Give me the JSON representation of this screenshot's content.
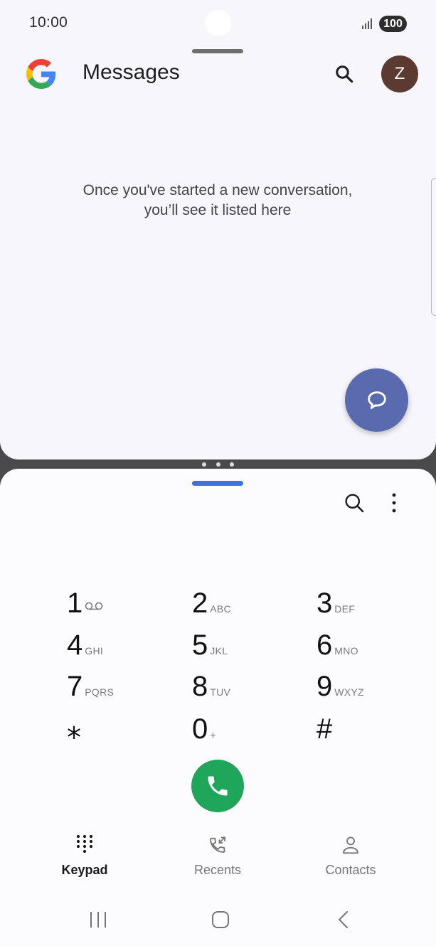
{
  "status_bar": {
    "time": "10:00",
    "battery": "100",
    "signal_icon": "signal-icon"
  },
  "messages": {
    "app_title": "Messages",
    "logo_icon": "google-logo",
    "search_icon": "search-icon",
    "avatar_initial": "Z",
    "avatar_color": "#5b3a32",
    "empty_line1": "Once you've started a new conversation,",
    "empty_line2": "you’ll see it listed here",
    "fab_icon": "start-chat-icon",
    "fab_color": "#5a6aaf"
  },
  "phone": {
    "accent_color": "#3a74e0",
    "call_color": "#1fa65a",
    "keys": [
      {
        "digit": "1",
        "letters": ""
      },
      {
        "digit": "2",
        "letters": "ABC"
      },
      {
        "digit": "3",
        "letters": "DEF"
      },
      {
        "digit": "4",
        "letters": "GHI"
      },
      {
        "digit": "5",
        "letters": "JKL"
      },
      {
        "digit": "6",
        "letters": "MNO"
      },
      {
        "digit": "7",
        "letters": "PQRS"
      },
      {
        "digit": "8",
        "letters": "TUV"
      },
      {
        "digit": "9",
        "letters": "WXYZ"
      },
      {
        "digit": "⁎",
        "letters": ""
      },
      {
        "digit": "0",
        "letters": "+"
      },
      {
        "digit": "#",
        "letters": ""
      }
    ],
    "tabs": [
      {
        "label": "Keypad",
        "icon": "keypad-icon",
        "active": true
      },
      {
        "label": "Recents",
        "icon": "recents-icon",
        "active": false
      },
      {
        "label": "Contacts",
        "icon": "contacts-icon",
        "active": false
      }
    ]
  },
  "system_nav": {
    "recent_apps_icon": "recent-apps-icon",
    "home_icon": "home-icon",
    "back_icon": "back-icon"
  }
}
